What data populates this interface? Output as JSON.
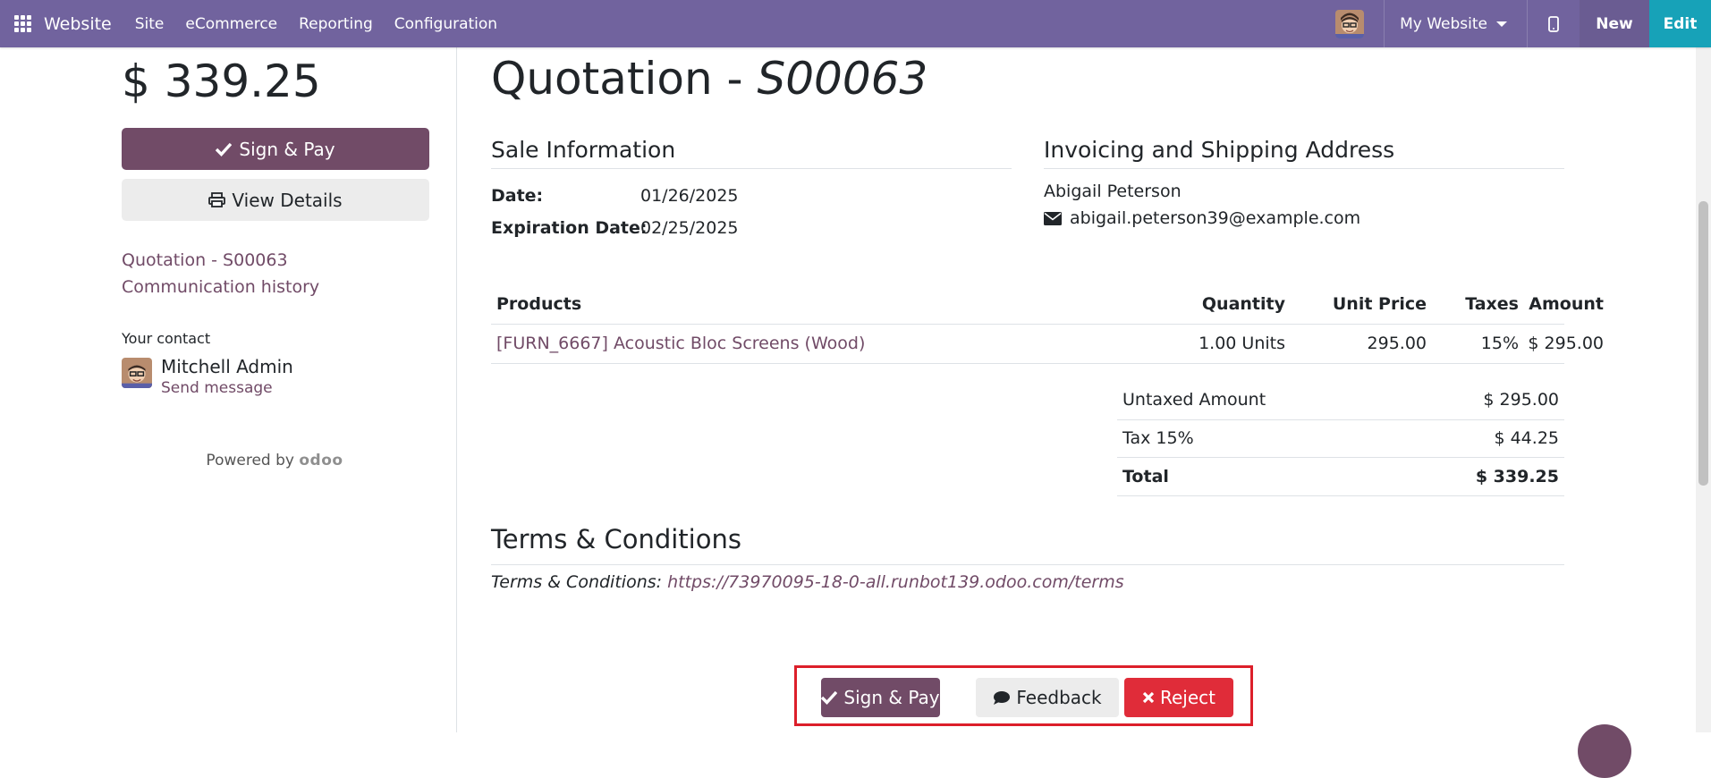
{
  "navbar": {
    "brand": "Website",
    "menu": [
      "Site",
      "eCommerce",
      "Reporting",
      "Configuration"
    ],
    "website_selector": "My Website",
    "new_label": "New",
    "edit_label": "Edit"
  },
  "sidebar": {
    "amount_total": "$ 339.25",
    "sign_pay_label": "Sign & Pay",
    "view_details_label": "View Details",
    "links": [
      "Quotation - S00063",
      "Communication history"
    ],
    "contact_label": "Your contact",
    "contact_name": "Mitchell Admin",
    "send_message": "Send message",
    "powered_by": "Powered by",
    "logo_text": "odoo"
  },
  "quotation": {
    "title_prefix": "Quotation - ",
    "number": "S00063",
    "sale_info_heading": "Sale Information",
    "date_label": "Date:",
    "date_value": "01/26/2025",
    "expiration_label": "Expiration Date:",
    "expiration_value": "02/25/2025",
    "address_heading": "Invoicing and Shipping Address",
    "customer_name": "Abigail Peterson",
    "customer_email": "abigail.peterson39@example.com"
  },
  "lines": {
    "headers": [
      "Products",
      "Quantity",
      "Unit Price",
      "Taxes",
      "Amount"
    ],
    "rows": [
      {
        "product": "[FURN_6667] Acoustic Bloc Screens (Wood)",
        "quantity": "1.00 Units",
        "unit_price": "295.00",
        "taxes": "15%",
        "amount": "$ 295.00"
      }
    ]
  },
  "totals": {
    "untaxed_label": "Untaxed Amount",
    "untaxed_value": "$ 295.00",
    "tax_label": "Tax 15%",
    "tax_value": "$ 44.25",
    "total_label": "Total",
    "total_value": "$ 339.25"
  },
  "terms": {
    "heading": "Terms & Conditions",
    "prefix": "Terms & Conditions:",
    "link": "https://73970095-18-0-all.runbot139.odoo.com/terms"
  },
  "actions": {
    "sign_pay": "Sign & Pay",
    "feedback": "Feedback",
    "reject": "Reject"
  },
  "colors": {
    "navbar": "#71639e",
    "primary": "#714b67",
    "edit": "#17a2b8",
    "reject": "#e02c39",
    "highlight_box": "#dc1f2a"
  }
}
